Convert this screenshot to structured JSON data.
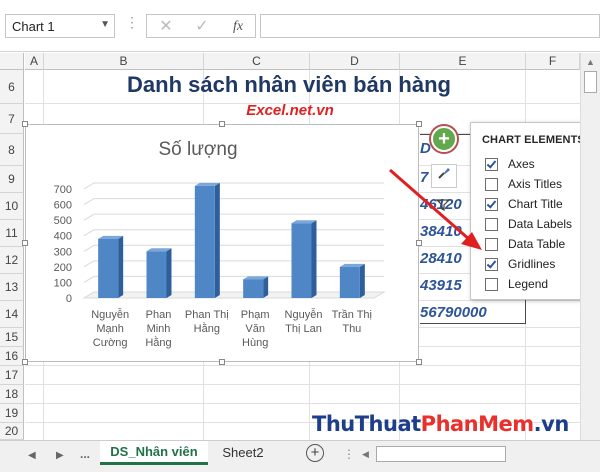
{
  "formula_bar": {
    "name_box": "Chart 1",
    "dots": "⋮",
    "cancel_icon": "✕",
    "enter_icon": "✓",
    "fx_label": "fx",
    "formula": ""
  },
  "columns": [
    "A",
    "B",
    "C",
    "D",
    "E",
    "F"
  ],
  "rows": [
    "6",
    "7",
    "8",
    "9",
    "10",
    "11",
    "12",
    "13",
    "14",
    "15",
    "16",
    "17",
    "18",
    "19",
    "20"
  ],
  "sheet": {
    "title": "Danh sách nhân viên bán hàng",
    "subtitle": "Excel.net.vn",
    "e_column": [
      "D",
      "7",
      "46120",
      "38410",
      "28410",
      "43915",
      "56790000"
    ]
  },
  "chart_data": {
    "type": "bar",
    "title": "Số lượng",
    "categories": [
      "Nguyễn Mạnh Cường",
      "Phan Minh Hằng",
      "Phan Thị Hằng",
      "Phạm Văn Hùng",
      "Nguyễn Thị Lan",
      "Trần Thị Thu"
    ],
    "category_lines": [
      [
        "Nguyễn",
        "Mạnh",
        "Cường"
      ],
      [
        "Phan",
        "Minh",
        "Hằng"
      ],
      [
        "Phan Thị",
        "Hằng"
      ],
      [
        "Phạm",
        "Văn",
        "Hùng"
      ],
      [
        "Nguyễn",
        "Thị Lan"
      ],
      [
        "Trần Thị",
        "Thu"
      ]
    ],
    "values": [
      380,
      300,
      720,
      120,
      480,
      200
    ],
    "ylim": [
      0,
      700
    ],
    "yticks": [
      "0",
      "100",
      "200",
      "300",
      "400",
      "500",
      "600",
      "700"
    ],
    "grid": true,
    "bar_color": "#4f86c6",
    "style": "3d-column"
  },
  "chart_elements": {
    "title": "CHART ELEMENTS",
    "options": [
      {
        "label": "Axes",
        "checked": true
      },
      {
        "label": "Axis Titles",
        "checked": false
      },
      {
        "label": "Chart Title",
        "checked": true
      },
      {
        "label": "Data Labels",
        "checked": false
      },
      {
        "label": "Data Table",
        "checked": false
      },
      {
        "label": "Gridlines",
        "checked": true
      },
      {
        "label": "Legend",
        "checked": false
      }
    ]
  },
  "chart_buttons": {
    "plus": "+",
    "brush": "🖌",
    "filter": "⏚"
  },
  "tabs": {
    "nav_dots": "...",
    "active": "DS_Nhân viên",
    "other": "Sheet2",
    "add": "+"
  },
  "watermark": {
    "part1": "ThuThuat",
    "part2": "PhanMem",
    "part3": ".vn"
  },
  "colors": {
    "accent": "#217346",
    "title": "#1f3864",
    "arrow": "#e02020"
  }
}
